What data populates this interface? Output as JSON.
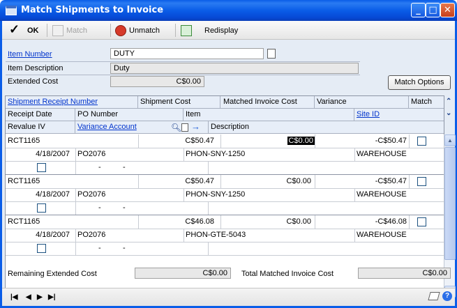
{
  "window": {
    "title": "Match Shipments to Invoice"
  },
  "toolbar": {
    "ok_label": "OK",
    "match_label": "Match",
    "unmatch_label": "Unmatch",
    "redisplay_label": "Redisplay"
  },
  "header": {
    "item_number_label": "Item Number",
    "item_number_value": "DUTY",
    "item_description_label": "Item Description",
    "item_description_value": "Duty",
    "extended_cost_label": "Extended Cost",
    "extended_cost_value": "C$0.00",
    "match_options_label": "Match Options"
  },
  "grid": {
    "headers_row1": {
      "shipment_receipt_number": "Shipment Receipt Number",
      "shipment_cost": "Shipment Cost",
      "matched_invoice_cost": "Matched Invoice Cost",
      "variance": "Variance",
      "match": "Match"
    },
    "headers_row2": {
      "receipt_date": "Receipt Date",
      "po_number": "PO Number",
      "item": "Item",
      "site_id": "Site ID"
    },
    "headers_row3": {
      "revalue_iv": "Revalue IV",
      "variance_account": "Variance Account",
      "description": "Description"
    },
    "rows": [
      {
        "receipt": "RCT1165",
        "shipment_cost": "C$50.47",
        "matched_cost": "C$0.00",
        "variance": "-C$50.47",
        "date": "4/18/2007",
        "po": "PO2076",
        "item": "PHON-SNY-1250",
        "site": "WAREHOUSE",
        "dash1": "-",
        "dash2": "-"
      },
      {
        "receipt": "RCT1165",
        "shipment_cost": "C$50.47",
        "matched_cost": "C$0.00",
        "variance": "-C$50.47",
        "date": "4/18/2007",
        "po": "PO2076",
        "item": "PHON-SNY-1250",
        "site": "WAREHOUSE",
        "dash1": "-",
        "dash2": "-"
      },
      {
        "receipt": "RCT1165",
        "shipment_cost": "C$46.08",
        "matched_cost": "C$0.00",
        "variance": "-C$46.08",
        "date": "4/18/2007",
        "po": "PO2076",
        "item": "PHON-GTE-5043",
        "site": "WAREHOUSE",
        "dash1": "-",
        "dash2": "-"
      }
    ]
  },
  "footer": {
    "remaining_extended_cost_label": "Remaining Extended Cost",
    "remaining_extended_cost_value": "C$0.00",
    "total_matched_invoice_cost_label": "Total Matched Invoice Cost",
    "total_matched_invoice_cost_value": "C$0.00"
  }
}
